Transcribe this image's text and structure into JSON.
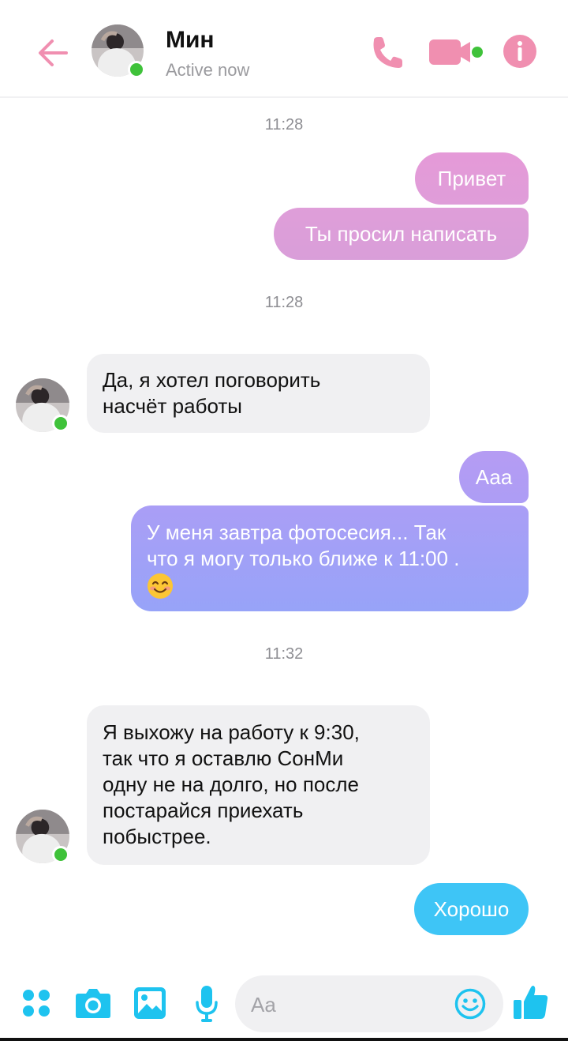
{
  "header": {
    "back_icon": "arrow-left-icon",
    "contact_name": "Мин",
    "contact_status": "Active now",
    "call_icon": "phone-icon",
    "video_icon": "video-camera-icon",
    "info_icon": "info-icon"
  },
  "colors": {
    "accent_pink": "#f08fb0",
    "online_green": "#3fc23a",
    "incoming_bubble": "#f0f0f2",
    "composer_cyan": "#1ec3ef"
  },
  "messages": {
    "ts1": "11:28",
    "m1": "Привет",
    "m2": "Ты просил написать",
    "ts2": "11:28",
    "m3_line1": "Да, я хотел поговорить",
    "m3_line2": "насчёт работы",
    "m4": "Ааа",
    "m5_line1": "У меня завтра фотосесия... Так",
    "m5_line2": "что я могу только ближе к 11:00 .",
    "m5_emoji": "smiling-face-emoji",
    "ts3": "11:32",
    "m6_line1": "Я выхожу на работу к 9:30,",
    "m6_line2": "так что я оставлю СонМи",
    "m6_line3": "одну не на долго, но после",
    "m6_line4": "постарайся приехать",
    "m6_line5": "побыстрее.",
    "m7": "Хорошо"
  },
  "composer": {
    "apps_icon": "four-dots-icon",
    "camera_icon": "camera-icon",
    "gallery_icon": "image-icon",
    "mic_icon": "microphone-icon",
    "placeholder": "Aa",
    "emoji_icon": "smiley-icon",
    "like_icon": "thumbs-up-icon"
  }
}
